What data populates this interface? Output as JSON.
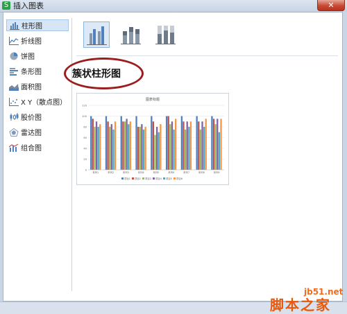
{
  "window": {
    "title": "插入图表",
    "app_icon_letter": "S",
    "close_label": "✕"
  },
  "sidebar": {
    "items": [
      {
        "label": "柱形图",
        "icon": "column-chart-icon",
        "active": true
      },
      {
        "label": "折线图",
        "icon": "line-chart-icon",
        "active": false
      },
      {
        "label": "饼图",
        "icon": "pie-chart-icon",
        "active": false
      },
      {
        "label": "条形图",
        "icon": "bar-chart-icon",
        "active": false
      },
      {
        "label": "面积图",
        "icon": "area-chart-icon",
        "active": false
      },
      {
        "label": "X Y（散点图）",
        "icon": "scatter-chart-icon",
        "active": false
      },
      {
        "label": "股价图",
        "icon": "stock-chart-icon",
        "active": false
      },
      {
        "label": "雷达图",
        "icon": "radar-chart-icon",
        "active": false
      },
      {
        "label": "组合图",
        "icon": "combo-chart-icon",
        "active": false
      }
    ]
  },
  "subtypes": [
    {
      "name": "clustered-column",
      "active": true
    },
    {
      "name": "stacked-column",
      "active": false
    },
    {
      "name": "percent-stacked-column",
      "active": false
    }
  ],
  "main": {
    "heading": "簇状柱形图"
  },
  "preview": {
    "title": "图表标题",
    "colors": [
      "#4f81bd",
      "#c0504d",
      "#9bbb59",
      "#8064a2",
      "#4bacc6",
      "#f79646"
    ],
    "y_ticks": [
      "120",
      "100",
      "80",
      "60",
      "40",
      "20",
      "0"
    ],
    "categories": [
      "系列1",
      "系列2",
      "系列3",
      "系列4",
      "系列5",
      "系列6",
      "系列7",
      "系列8",
      "系列9"
    ],
    "legend": [
      "项目1",
      "项目2",
      "项目3",
      "项目4",
      "项目5",
      "项目6"
    ]
  },
  "chart_data": {
    "type": "bar",
    "title": "图表标题",
    "ylim": [
      0,
      120
    ],
    "categories": [
      "系列1",
      "系列2",
      "系列3",
      "系列4",
      "系列5",
      "系列6",
      "系列7",
      "系列8",
      "系列9"
    ],
    "series": [
      {
        "name": "项目1",
        "values": [
          100,
          100,
          100,
          100,
          100,
          100,
          100,
          100,
          100
        ]
      },
      {
        "name": "项目2",
        "values": [
          95,
          90,
          90,
          80,
          90,
          100,
          90,
          90,
          95
        ]
      },
      {
        "name": "项目3",
        "values": [
          80,
          80,
          90,
          80,
          65,
          85,
          75,
          75,
          85
        ]
      },
      {
        "name": "项目4",
        "values": [
          90,
          85,
          95,
          85,
          80,
          90,
          90,
          90,
          95
        ]
      },
      {
        "name": "项目5",
        "values": [
          80,
          75,
          85,
          75,
          70,
          75,
          80,
          80,
          70
        ]
      },
      {
        "name": "项目6",
        "values": [
          85,
          90,
          90,
          80,
          85,
          95,
          90,
          95,
          95
        ]
      }
    ],
    "grid": true,
    "legend_position": "bottom"
  },
  "watermark": {
    "url": "jb51.net",
    "site": "脚本之家"
  }
}
